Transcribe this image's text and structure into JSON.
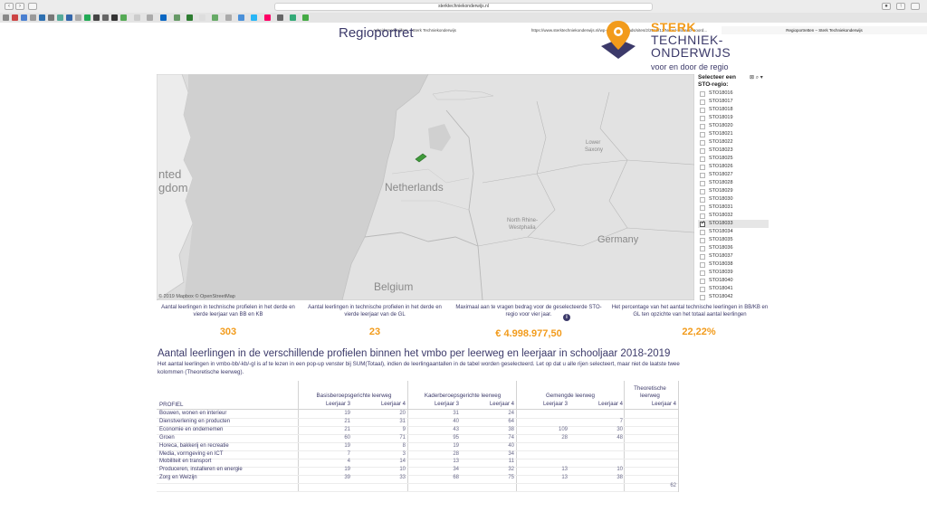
{
  "browser": {
    "url": "sterktechniekonderwijs.nl",
    "tabs": [
      {
        "label": "Arbeidsmarktcijfers – Sterk Techniekonderwijs",
        "active": false
      },
      {
        "label": "https://www.sterktechniekonderwijs.nl/wp-content/uploads/sites/2/2019/12/Noord-Holland-Noord...",
        "active": false
      },
      {
        "label": "Regioportretten – Sterk Techniekonderwijs",
        "active": true
      }
    ]
  },
  "header": {
    "title": "Regioportret",
    "logo": {
      "line1": "STERK",
      "line2": "TECHNIEK-",
      "line3": "ONDERWIJS",
      "tagline": "voor en door de regio"
    }
  },
  "map": {
    "labels": [
      "nted",
      "gdom",
      "Netherlands",
      "Belgium",
      "Germany",
      "North Rhine-",
      "Westphalia",
      "Lower",
      "Saxony"
    ],
    "attribution": "© 2019 Mapbox  © OpenStreetMap"
  },
  "filter": {
    "title": "Selecteer een STO-regio:",
    "items": [
      {
        "label": "STO18016",
        "checked": false
      },
      {
        "label": "STO18017",
        "checked": false
      },
      {
        "label": "STO18018",
        "checked": false
      },
      {
        "label": "STO18019",
        "checked": false
      },
      {
        "label": "STO18020",
        "checked": false
      },
      {
        "label": "STO18021",
        "checked": false
      },
      {
        "label": "STO18022",
        "checked": false
      },
      {
        "label": "STO18023",
        "checked": false
      },
      {
        "label": "STO18025",
        "checked": false
      },
      {
        "label": "STO18026",
        "checked": false
      },
      {
        "label": "STO18027",
        "checked": false
      },
      {
        "label": "STO18028",
        "checked": false
      },
      {
        "label": "STO18029",
        "checked": false
      },
      {
        "label": "STO18030",
        "checked": false
      },
      {
        "label": "STO18031",
        "checked": false
      },
      {
        "label": "STO18032",
        "checked": false
      },
      {
        "label": "STO18033",
        "checked": true
      },
      {
        "label": "STO18034",
        "checked": false
      },
      {
        "label": "STO18035",
        "checked": false
      },
      {
        "label": "STO18036",
        "checked": false
      },
      {
        "label": "STO18037",
        "checked": false
      },
      {
        "label": "STO18038",
        "checked": false
      },
      {
        "label": "STO18039",
        "checked": false
      },
      {
        "label": "STO18040",
        "checked": false
      },
      {
        "label": "STO18041",
        "checked": false
      },
      {
        "label": "STO18042",
        "checked": false
      }
    ]
  },
  "kpis": [
    {
      "label": "Aantal leerlingen in technische profielen in het derde en vierde leerjaar van BB en KB",
      "value": "303"
    },
    {
      "label": "Aantal leerlingen in technische profielen in het derde en vierde leerjaar van de GL",
      "value": "23"
    },
    {
      "label": "Maximaal aan te vragen bedrag voor de geselecteerde STO-regio voor vier jaar.",
      "value": "€ 4.998.977,50"
    },
    {
      "label": "Het percentage van het aantal technische leerlingen in BB/KB en GL ten opzichte van het totaal aantal leerlingen",
      "value": "22,22%"
    }
  ],
  "section": {
    "title": "Aantal leerlingen in de verschillende profielen binnen het vmbo per leerweg en leerjaar in schooljaar  2018-2019",
    "desc": "Het aantal leerlingen in vmbo-bb/-kb/-gl is af te lezen in een pop-up venster bij SUM(Totaal), indien de leerlingaantallen in de tabel worden geselecteerd. Let op dat u alle rijen selecteert, maar niet de laatste twee kolommen (Theoretische leerweg)."
  },
  "table": {
    "profiel_header": "PROFIEL",
    "groups": [
      "Basisberoepsgerichte leerweg",
      "Kaderberoepsgerichte leerweg",
      "Gemengde leerweg",
      "Theoretische leerweg"
    ],
    "subheaders": [
      "Leerjaar 3",
      "Leerjaar 4",
      "Leerjaar 3",
      "Leerjaar 4",
      "Leerjaar 3",
      "Leerjaar 4",
      "Leerjaar 4"
    ],
    "rows": [
      {
        "label": "Bouwen, wonen en interieur",
        "cells": [
          "19",
          "20",
          "31",
          "24",
          "",
          "",
          ""
        ]
      },
      {
        "label": "Dienstverlening en producten",
        "cells": [
          "21",
          "31",
          "40",
          "64",
          "",
          "7",
          ""
        ]
      },
      {
        "label": "Economie en ondernemen",
        "cells": [
          "21",
          "9",
          "43",
          "38",
          "109",
          "30",
          ""
        ]
      },
      {
        "label": "Groen",
        "cells": [
          "60",
          "71",
          "95",
          "74",
          "28",
          "48",
          ""
        ]
      },
      {
        "label": "Horeca, bakkerij en recreatie",
        "cells": [
          "19",
          "8",
          "19",
          "40",
          "",
          "",
          ""
        ]
      },
      {
        "label": "Media, vormgeving en ICT",
        "cells": [
          "7",
          "3",
          "28",
          "34",
          "",
          "",
          ""
        ]
      },
      {
        "label": "Mobiliteit en transport",
        "cells": [
          "4",
          "14",
          "13",
          "11",
          "",
          "",
          ""
        ]
      },
      {
        "label": "Produceren, installeren en energie",
        "cells": [
          "19",
          "10",
          "34",
          "32",
          "13",
          "10",
          ""
        ]
      },
      {
        "label": "Zorg en Welzijn",
        "cells": [
          "39",
          "33",
          "68",
          "75",
          "13",
          "38",
          ""
        ]
      },
      {
        "label": "",
        "cells": [
          "",
          "",
          "",
          "",
          "",
          "",
          "62"
        ]
      }
    ]
  }
}
